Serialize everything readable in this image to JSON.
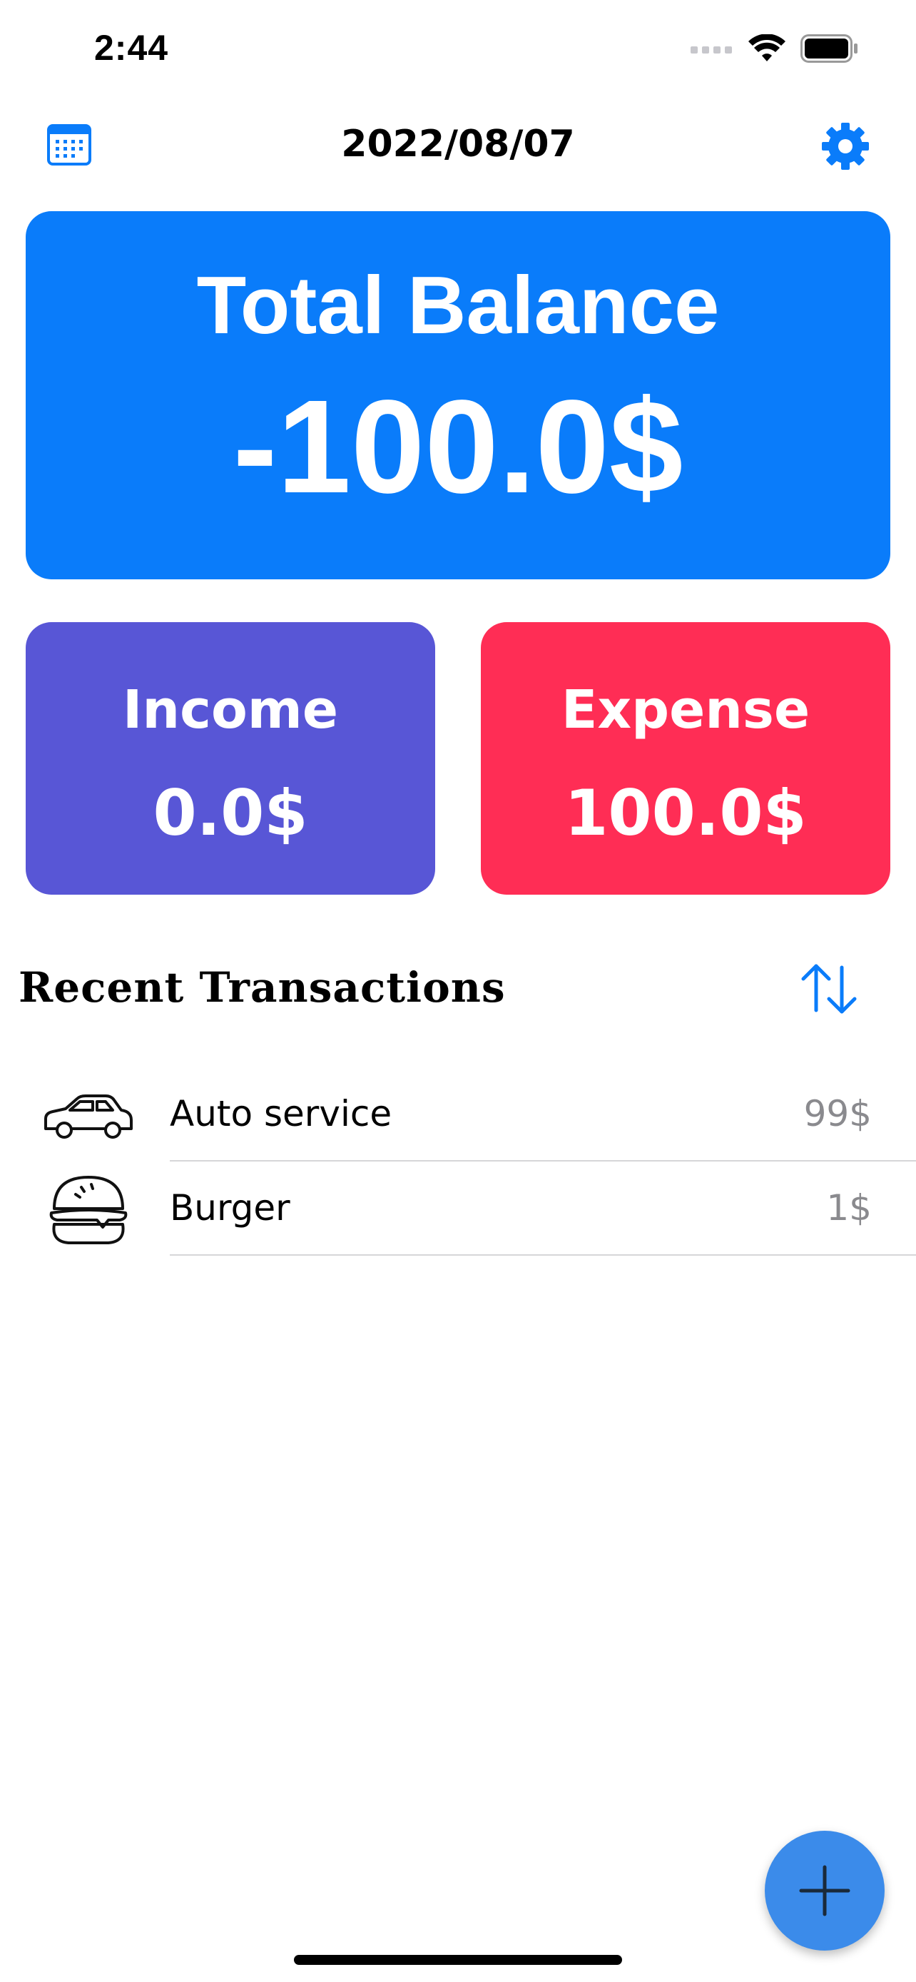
{
  "status_bar": {
    "time": "2:44"
  },
  "header": {
    "date": "2022/08/07",
    "calendar_icon": "calendar-icon",
    "settings_icon": "gear-icon"
  },
  "balance": {
    "title": "Total Balance",
    "value": "-100.0$"
  },
  "income": {
    "title": "Income",
    "value": "0.0$"
  },
  "expense": {
    "title": "Expense",
    "value": "100.0$"
  },
  "recent": {
    "title": "Recent Transactions",
    "sort_icon": "sort-arrows-icon",
    "transactions": [
      {
        "icon": "car-icon",
        "label": "Auto service",
        "amount": "99$"
      },
      {
        "icon": "burger-icon",
        "label": "Burger",
        "amount": "1$"
      }
    ]
  },
  "fab": {
    "icon": "plus-icon"
  },
  "colors": {
    "accent": "#0a7cfa",
    "income": "#5856d6",
    "expense": "#ff2d55",
    "fab": "#3b8bea",
    "amount_text": "#8a8a8e"
  }
}
